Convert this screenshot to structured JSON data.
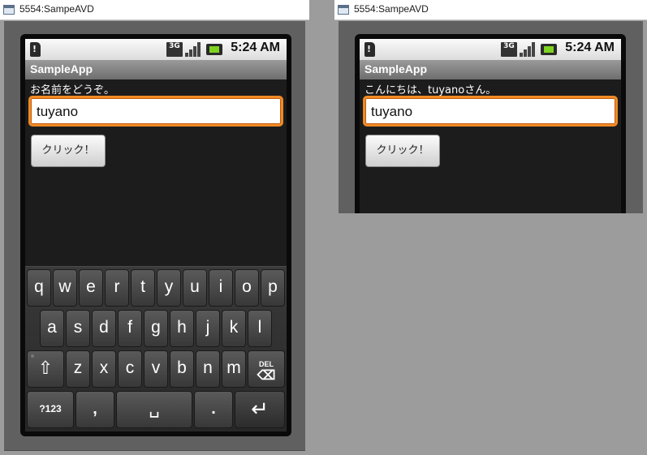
{
  "windows": [
    {
      "title": "5554:SampeAVD",
      "status": {
        "network": "3G",
        "time": "5:24 AM"
      },
      "app_title": "SampleApp",
      "prompt": "お名前をどうぞ。",
      "input_value": "tuyano",
      "button_label": "クリック！",
      "keyboard": {
        "row1": [
          "q",
          "w",
          "e",
          "r",
          "t",
          "y",
          "u",
          "i",
          "o",
          "p"
        ],
        "row2": [
          "a",
          "s",
          "d",
          "f",
          "g",
          "h",
          "j",
          "k",
          "l"
        ],
        "row3": [
          "z",
          "x",
          "c",
          "v",
          "b",
          "n",
          "m"
        ],
        "shift_icon": "⇧",
        "del_label": "DEL",
        "del_icon": "⌫",
        "sym_label": "?123",
        "comma": ",",
        "space_icon": "␣",
        "period": ".",
        "enter_icon": "↵"
      }
    },
    {
      "title": "5554:SampeAVD",
      "status": {
        "network": "3G",
        "time": "5:24 AM"
      },
      "app_title": "SampleApp",
      "prompt": "こんにちは、tuyanoさん。",
      "input_value": "tuyano",
      "button_label": "クリック！"
    }
  ],
  "colors": {
    "focus_border": "#f08a24",
    "desktop": "#9c9c9c",
    "screen_bg": "#1c1c1c"
  }
}
